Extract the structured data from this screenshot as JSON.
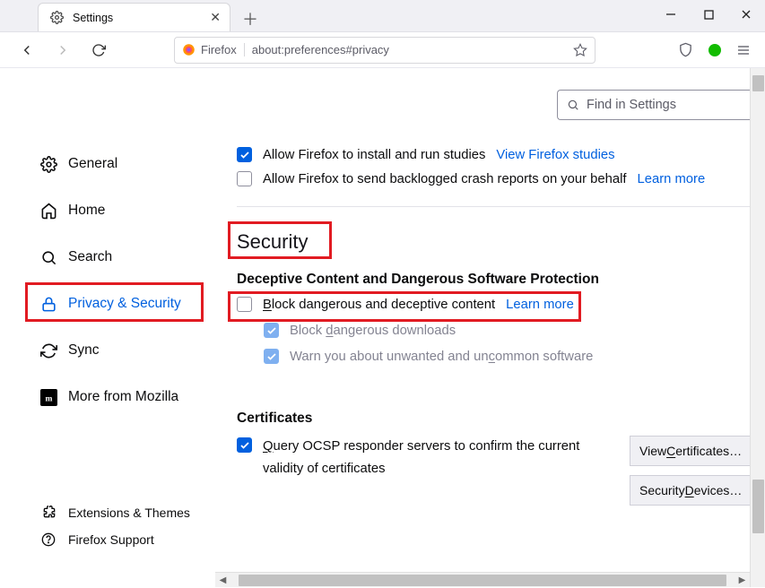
{
  "window": {
    "tab_title": "Settings"
  },
  "urlbar": {
    "identity": "Firefox",
    "url": "about:preferences#privacy"
  },
  "find_placeholder": "Find in Settings",
  "sidebar": {
    "items": [
      {
        "label": "General"
      },
      {
        "label": "Home"
      },
      {
        "label": "Search"
      },
      {
        "label": "Privacy & Security"
      },
      {
        "label": "Sync"
      },
      {
        "label": "More from Mozilla"
      }
    ],
    "bottom": [
      {
        "label": "Extensions & Themes"
      },
      {
        "label": "Firefox Support"
      }
    ]
  },
  "studies": {
    "allow_label": "Allow Firefox to install and run studies",
    "view_link": "View Firefox studies",
    "crash_label": "Allow Firefox to send backlogged crash reports on your behalf",
    "learn_more": "Learn more"
  },
  "security": {
    "heading": "Security",
    "sub": "Deceptive Content and Dangerous Software Protection",
    "block_label_pre": "B",
    "block_label_rest": "lock dangerous and deceptive content",
    "learn_more": "Learn more",
    "dl_pre": "Block ",
    "dl_u": "d",
    "dl_rest": "angerous downloads",
    "warn_pre": "Warn you about unwanted and un",
    "warn_u": "c",
    "warn_rest": "ommon software"
  },
  "certs": {
    "heading": "Certificates",
    "ocsp_pre": "Q",
    "ocsp_rest": "uery OCSP responder servers to confirm the current validity of certificates",
    "view_btn_pre": "View ",
    "view_btn_u": "C",
    "view_btn_rest": "ertificates…",
    "dev_btn_pre": "Security ",
    "dev_btn_u": "D",
    "dev_btn_rest": "evices…"
  }
}
